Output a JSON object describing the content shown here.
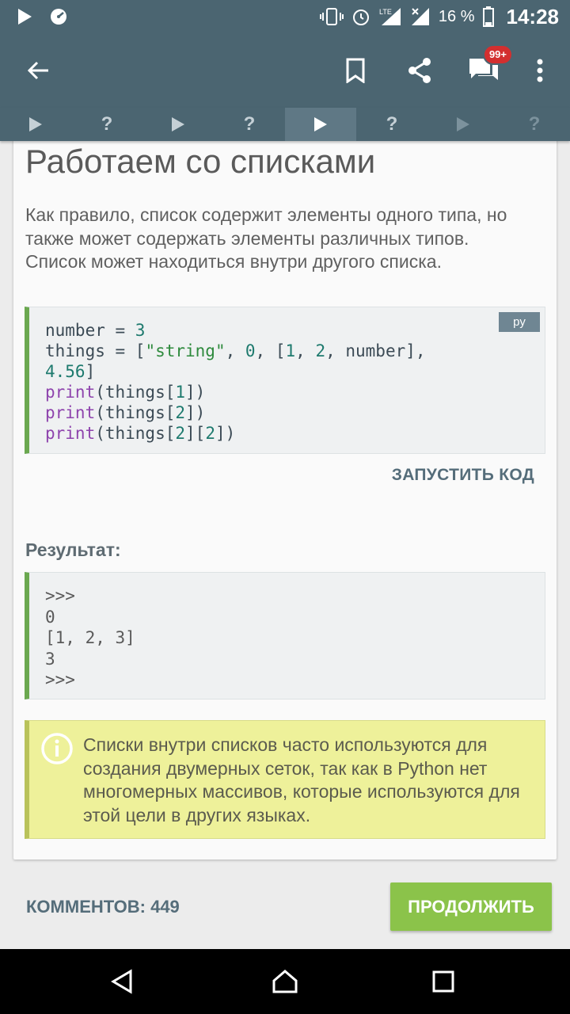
{
  "status_bar": {
    "battery_percent": "16 %",
    "time": "14:28",
    "network": "LTE"
  },
  "app_bar": {
    "notification_badge": "99+"
  },
  "step_tabs": [
    {
      "icon": "play-icon",
      "state": "done"
    },
    {
      "icon": "question-icon",
      "state": "done",
      "symbol": "?"
    },
    {
      "icon": "play-icon",
      "state": "done"
    },
    {
      "icon": "question-icon",
      "state": "done",
      "symbol": "?"
    },
    {
      "icon": "play-icon",
      "state": "active"
    },
    {
      "icon": "question-icon",
      "state": "upcoming",
      "symbol": "?"
    },
    {
      "icon": "play-icon",
      "state": "locked"
    },
    {
      "icon": "question-icon",
      "state": "locked",
      "symbol": "?"
    }
  ],
  "lesson": {
    "title": "Работаем со списками",
    "paragraph": "Как правило, список содержит элементы одного типа, но также может содержать элементы различных типов.\nСписок может находиться внутри другого списка.",
    "code": {
      "language_tag": "py",
      "lines": [
        "number = 3",
        "things = [\"string\", 0, [1, 2, number], 4.56]",
        "print(things[1])",
        "print(things[2])",
        "print(things[2][2])"
      ]
    },
    "run_button": "ЗАПУСТИТЬ КОД",
    "result_label": "Результат:",
    "result_lines": [
      ">>>",
      "0",
      "[1, 2, 3]",
      "3",
      ">>>"
    ],
    "info_text": "Списки внутри списков часто используются для создания двумерных сеток, так как в Python нет многомерных массивов, которые используются для этой цели в других языках."
  },
  "footer": {
    "comments_label": "КОММЕНТОВ: 449",
    "continue_button": "ПРОДОЛЖИТЬ"
  },
  "colors": {
    "app_bar": "#4b6571",
    "code_border": "#6aa84f",
    "info_background": "#eef19a",
    "continue_button": "#8bc34a"
  }
}
